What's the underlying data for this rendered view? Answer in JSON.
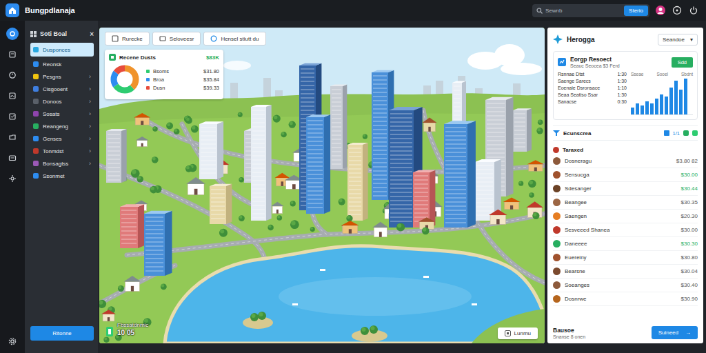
{
  "app": {
    "title": "Bungpdlanaja"
  },
  "search": {
    "placeholder": "Sewnb",
    "button": "Sterio"
  },
  "rail": {
    "items": [
      {
        "selected": true
      },
      {
        "selected": false
      },
      {
        "selected": false
      },
      {
        "selected": false
      },
      {
        "selected": false
      },
      {
        "selected": false
      },
      {
        "selected": false
      },
      {
        "selected": false
      }
    ]
  },
  "sidebar": {
    "title": "Soti Boal",
    "close": "×",
    "items": [
      {
        "label": "Dusponces",
        "selected": true,
        "color": "#29a9e1"
      },
      {
        "label": "Reonsk",
        "selected": false,
        "color": "#2d8cf0"
      },
      {
        "label": "Pesgns",
        "selected": false,
        "color": "#f1c40f",
        "arrow": "›"
      },
      {
        "label": "Cisgooent",
        "selected": false,
        "color": "#3f7fe0",
        "arrow": "›"
      },
      {
        "label": "Donoos",
        "selected": false,
        "color": "#5a6069",
        "arrow": "›"
      },
      {
        "label": "Sosats",
        "selected": false,
        "color": "#8e44ad",
        "arrow": "›"
      },
      {
        "label": "Reangeng",
        "selected": false,
        "color": "#27ae60",
        "arrow": "›"
      },
      {
        "label": "Genses",
        "selected": false,
        "color": "#2d8cf0",
        "arrow": "›"
      },
      {
        "label": "Tonmdst",
        "selected": false,
        "color": "#c0392b",
        "arrow": "›"
      },
      {
        "label": "Bonsagtss",
        "selected": false,
        "color": "#9b59b6",
        "arrow": "›"
      },
      {
        "label": "Ssonmet",
        "selected": false,
        "color": "#2d8cf0"
      }
    ],
    "button": "Ritonne"
  },
  "map": {
    "tabs": [
      {
        "label": "Rurecke"
      },
      {
        "label": "Seloveesr"
      },
      {
        "label": "Hensel stiutt du"
      }
    ],
    "summary": {
      "title": "Recene Dusts",
      "badge": "$83K",
      "donut": [
        {
          "value": 38,
          "color": "#f0932b"
        },
        {
          "value": 27,
          "color": "#2ecc71"
        },
        {
          "value": 20,
          "color": "#2d8cf0"
        },
        {
          "value": 15,
          "color": "#e74c3c"
        }
      ],
      "rows": [
        {
          "label": "Bsoms",
          "value": "$31.80",
          "color": "#2ecc71"
        },
        {
          "label": "Broa",
          "value": "$35.84",
          "color": "#2d8cf0"
        },
        {
          "label": "Dusn",
          "value": "$39.33",
          "color": "#e74c3c"
        }
      ]
    },
    "caption": {
      "title": "Fbssatdnmic",
      "value": "10 05"
    },
    "chip": "Lunmu"
  },
  "panel": {
    "title": "Herogga",
    "dropdown": {
      "value": "Seandoe",
      "arrow": "▾"
    },
    "card": {
      "title": "Eorgp Resoect",
      "subtitle": "Seauc Seocea $3 Ferd",
      "button": "Sdd",
      "rows": [
        {
          "label": "Rsnnae Dtst",
          "value": "1:30"
        },
        {
          "label": "Saenge Sarecs",
          "value": "1:30"
        },
        {
          "label": "Eoenaie Dsronsace",
          "value": "1:10"
        },
        {
          "label": "Seaa Seatiso Ssar",
          "value": "1:30"
        },
        {
          "label": "Sanacse",
          "value": "0:30"
        }
      ],
      "chart": {
        "columns": [
          "Sseae",
          "Sooel",
          "Sbdnt"
        ],
        "values": [
          3,
          5,
          4,
          6,
          5,
          7,
          9,
          8,
          12,
          15,
          11,
          16
        ]
      }
    },
    "filter": {
      "label": "Ecunscrea",
      "count": "1/1"
    },
    "list": {
      "title": "Taraxed",
      "rows": [
        {
          "name": "Dosneragu",
          "amount": "$3.80 82",
          "color": "#8d5a3b",
          "positive": false
        },
        {
          "name": "Sensucga",
          "amount": "$30.00",
          "color": "#a0522d",
          "positive": true
        },
        {
          "name": "Sdesanger",
          "amount": "$30.44",
          "color": "#6b4226",
          "positive": true
        },
        {
          "name": "Beangee",
          "amount": "$30.35",
          "color": "#9c6644",
          "positive": false
        },
        {
          "name": "Saengen",
          "amount": "$20.30",
          "color": "#e67e22",
          "positive": false
        },
        {
          "name": "Sesveeed Shanea",
          "amount": "$30.00",
          "color": "#c0392b",
          "positive": false
        },
        {
          "name": "Daneeee",
          "amount": "$30.30",
          "color": "#27ae60",
          "positive": true
        },
        {
          "name": "Euereiny",
          "amount": "$30.80",
          "color": "#a0522d",
          "positive": false
        },
        {
          "name": "Bearsne",
          "amount": "$30.04",
          "color": "#7b4a2e",
          "positive": false
        },
        {
          "name": "Soeanges",
          "amount": "$30.40",
          "color": "#8d5a3b",
          "positive": false
        },
        {
          "name": "Dosnrwe",
          "amount": "$30.90",
          "color": "#b5651d",
          "positive": false
        }
      ]
    },
    "footer": {
      "label": "Bausoe",
      "sub": "Snanse 8 onen",
      "button": "Suineed",
      "arrow": "→"
    }
  }
}
